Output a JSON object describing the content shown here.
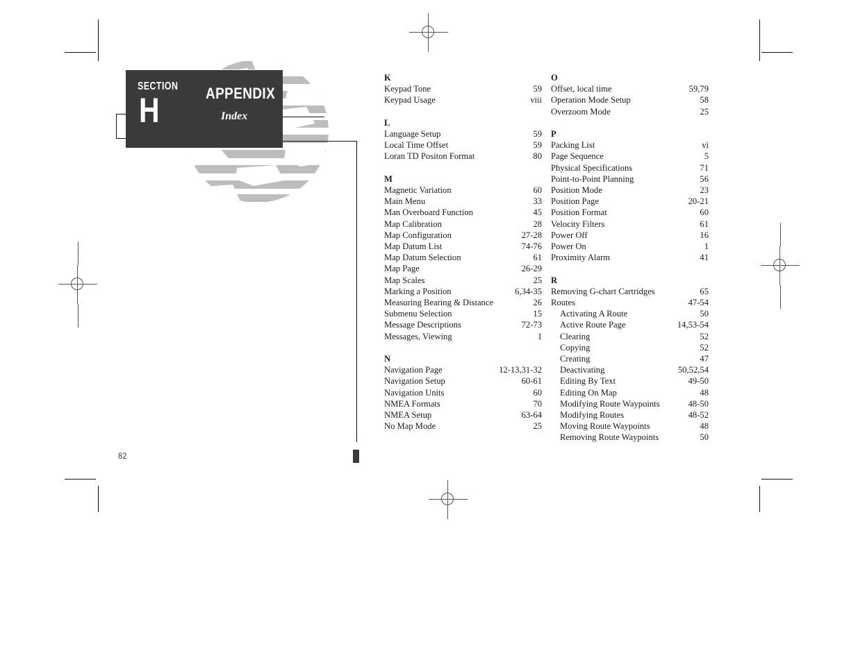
{
  "page": {
    "number": "82",
    "section_tab": {
      "section_word": "SECTION",
      "section_letter": "H",
      "appendix_word": "APPENDIX",
      "appendix_subtitle": "Index"
    },
    "colors": {
      "tab_background": "#3a3a38",
      "tab_text": "#ffffff",
      "body_text": "#1a1a1a",
      "watermark": "#bdbdbd",
      "rule": "#111111"
    }
  },
  "index": {
    "columns": [
      {
        "name": "left-column",
        "groups": [
          {
            "letter": "K",
            "entries": [
              {
                "label": "Keypad Tone",
                "pages": "59",
                "sub": false
              },
              {
                "label": "Keypad Usage",
                "pages": "viii",
                "sub": false
              }
            ]
          },
          {
            "letter": "L",
            "entries": [
              {
                "label": "Language Setup",
                "pages": "59",
                "sub": false
              },
              {
                "label": "Local Time Offset",
                "pages": "59",
                "sub": false
              },
              {
                "label": "Loran TD Positon Format",
                "pages": "80",
                "sub": false
              }
            ]
          },
          {
            "letter": "M",
            "entries": [
              {
                "label": "Magnetic Variation",
                "pages": "60",
                "sub": false
              },
              {
                "label": "Main Menu",
                "pages": "33",
                "sub": false
              },
              {
                "label": "Man Overboard Function",
                "pages": "45",
                "sub": false
              },
              {
                "label": "Map Calibration",
                "pages": "28",
                "sub": false
              },
              {
                "label": "Map Configuration",
                "pages": "27-28",
                "sub": false
              },
              {
                "label": "Map Datum List",
                "pages": "74-76",
                "sub": false
              },
              {
                "label": "Map Datum Selection",
                "pages": "61",
                "sub": false
              },
              {
                "label": "Map Page",
                "pages": "26-29",
                "sub": false
              },
              {
                "label": "Map Scales",
                "pages": "25",
                "sub": false
              },
              {
                "label": "Marking a Position",
                "pages": "6,34-35",
                "sub": false
              },
              {
                "label": "Measuring Bearing & Distance",
                "pages": "26",
                "sub": false
              },
              {
                "label": "Submenu Selection",
                "pages": "15",
                "sub": false
              },
              {
                "label": "Message Descriptions",
                "pages": "72-73",
                "sub": false
              },
              {
                "label": "Messages, Viewing",
                "pages": "1",
                "sub": false
              }
            ]
          },
          {
            "letter": "N",
            "entries": [
              {
                "label": "Navigation Page",
                "pages": "12-13,31-32",
                "sub": false
              },
              {
                "label": "Navigation Setup",
                "pages": "60-61",
                "sub": false
              },
              {
                "label": "Navigation Units",
                "pages": "60",
                "sub": false
              },
              {
                "label": "NMEA Formats",
                "pages": "70",
                "sub": false
              },
              {
                "label": "NMEA Setup",
                "pages": "63-64",
                "sub": false
              },
              {
                "label": "No Map Mode",
                "pages": "25",
                "sub": false
              }
            ]
          }
        ]
      },
      {
        "name": "right-column",
        "groups": [
          {
            "letter": "O",
            "entries": [
              {
                "label": "Offset, local time",
                "pages": "59,79",
                "sub": false
              },
              {
                "label": "Operation Mode Setup",
                "pages": "58",
                "sub": false
              },
              {
                "label": "Overzoom Mode",
                "pages": "25",
                "sub": false
              }
            ]
          },
          {
            "letter": "P",
            "entries": [
              {
                "label": "Packing List",
                "pages": "vi",
                "sub": false
              },
              {
                "label": "Page Sequence",
                "pages": "5",
                "sub": false
              },
              {
                "label": "Physical Specifications",
                "pages": "71",
                "sub": false
              },
              {
                "label": "Point-to-Point Planning",
                "pages": "56",
                "sub": false
              },
              {
                "label": "Position Mode",
                "pages": "23",
                "sub": false
              },
              {
                "label": "Position Page",
                "pages": "20-21",
                "sub": false
              },
              {
                "label": "Position Format",
                "pages": "60",
                "sub": false
              },
              {
                "label": "Velocity Filters",
                "pages": "61",
                "sub": false
              },
              {
                "label": "Power Off",
                "pages": "16",
                "sub": false
              },
              {
                "label": "Power On",
                "pages": "1",
                "sub": false
              },
              {
                "label": "Proximity Alarm",
                "pages": "41",
                "sub": false
              }
            ]
          },
          {
            "letter": "R",
            "entries": [
              {
                "label": "Removing G-chart Cartridges",
                "pages": "65",
                "sub": false
              },
              {
                "label": "Routes",
                "pages": "47-54",
                "sub": false
              },
              {
                "label": "Activating A Route",
                "pages": "50",
                "sub": true
              },
              {
                "label": "Active Route Page",
                "pages": "14,53-54",
                "sub": true
              },
              {
                "label": "Clearing",
                "pages": "52",
                "sub": true
              },
              {
                "label": "Copying",
                "pages": "52",
                "sub": true
              },
              {
                "label": "Creating",
                "pages": "47",
                "sub": true
              },
              {
                "label": "Deactivating",
                "pages": "50,52,54",
                "sub": true
              },
              {
                "label": "Editing By Text",
                "pages": "49-50",
                "sub": true
              },
              {
                "label": "Editing On Map",
                "pages": "48",
                "sub": true
              },
              {
                "label": "Modifying Route Waypoints",
                "pages": "48-50",
                "sub": true
              },
              {
                "label": "Modifying Routes",
                "pages": "48-52",
                "sub": true
              },
              {
                "label": "Moving Route Waypoints",
                "pages": "48",
                "sub": true
              },
              {
                "label": "Removing Route Waypoints",
                "pages": "50",
                "sub": true
              }
            ]
          }
        ]
      }
    ]
  }
}
